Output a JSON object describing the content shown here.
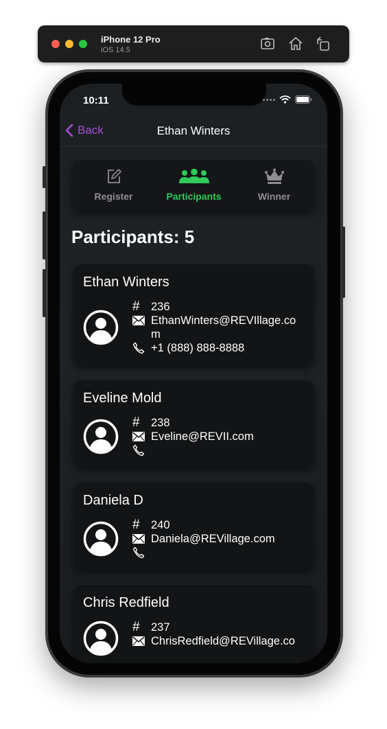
{
  "simulator": {
    "device": "iPhone 12 Pro",
    "os": "iOS 14.5",
    "icons": [
      "screenshot-icon",
      "home-icon",
      "rotate-icon"
    ]
  },
  "status_bar": {
    "time": "10:11"
  },
  "nav": {
    "back_label": "Back",
    "title": "Ethan Winters"
  },
  "tabs": [
    {
      "label": "Register",
      "icon": "edit-icon",
      "active": false
    },
    {
      "label": "Participants",
      "icon": "group-icon",
      "active": true
    },
    {
      "label": "Winner",
      "icon": "crown-icon",
      "active": false
    }
  ],
  "section_title": "Participants: 5",
  "participants": [
    {
      "name": "Ethan Winters",
      "number": "236",
      "email": "EthanWinters@REVIllage.com",
      "phone": "+1 (888) 888-8888"
    },
    {
      "name": "Eveline Mold",
      "number": "238",
      "email": "Eveline@REVII.com",
      "phone": ""
    },
    {
      "name": "Daniela D",
      "number": "240",
      "email": "Daniela@REVillage.com",
      "phone": ""
    },
    {
      "name": "Chris Redfield",
      "number": "237",
      "email": "ChrisRedfield@REVillage.co",
      "phone": ""
    }
  ],
  "colors": {
    "accent_back": "#a94bdf",
    "tab_active": "#30c95a",
    "tab_inactive": "#8e8e93"
  }
}
